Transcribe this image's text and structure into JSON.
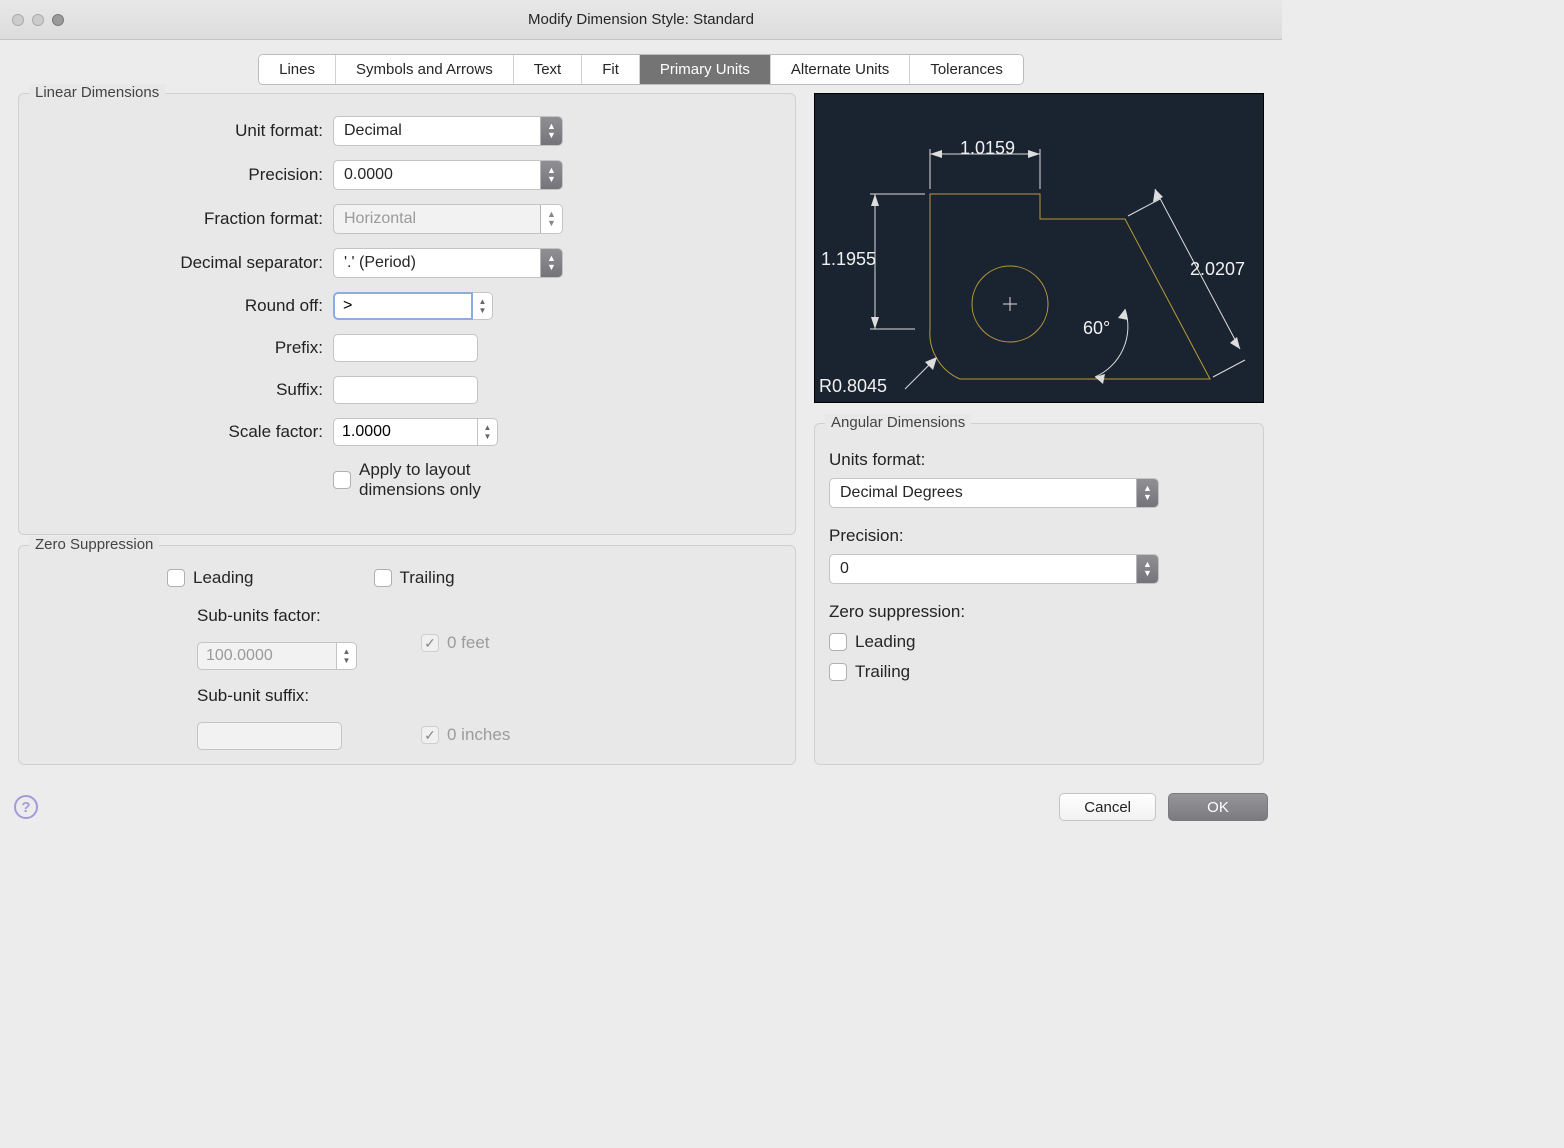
{
  "title": "Modify Dimension Style: Standard",
  "tabs": [
    "Lines",
    "Symbols and Arrows",
    "Text",
    "Fit",
    "Primary Units",
    "Alternate Units",
    "Tolerances"
  ],
  "active_tab": "Primary Units",
  "linear": {
    "title": "Linear Dimensions",
    "unit_format_label": "Unit format:",
    "unit_format": "Decimal",
    "precision_label": "Precision:",
    "precision": "0.0000",
    "fraction_format_label": "Fraction format:",
    "fraction_format": "Horizontal",
    "decimal_separator_label": "Decimal separator:",
    "decimal_separator": "'.' (Period)",
    "round_off_label": "Round off:",
    "round_off": ">",
    "prefix_label": "Prefix:",
    "prefix": "",
    "suffix_label": "Suffix:",
    "suffix": "",
    "scale_factor_label": "Scale factor:",
    "scale_factor": "1.0000",
    "apply_layout_label": "Apply to layout dimensions only"
  },
  "zero": {
    "title": "Zero Suppression",
    "leading_label": "Leading",
    "trailing_label": "Trailing",
    "sub_factor_label": "Sub-units factor:",
    "sub_factor": "100.0000",
    "sub_suffix_label": "Sub-unit suffix:",
    "sub_suffix": "",
    "zero_feet_label": "0 feet",
    "zero_inches_label": "0 inches"
  },
  "angular": {
    "title": "Angular Dimensions",
    "units_format_label": "Units format:",
    "units_format": "Decimal Degrees",
    "precision_label": "Precision:",
    "precision": "0",
    "zero_suppress_label": "Zero suppression:",
    "leading_label": "Leading",
    "trailing_label": "Trailing"
  },
  "preview": {
    "dim_top": "1.0159",
    "dim_left": "1.1955",
    "dim_diag": "2.0207",
    "dim_angle": "60°",
    "dim_radius": "R0.8045"
  },
  "buttons": {
    "cancel": "Cancel",
    "ok": "OK"
  }
}
